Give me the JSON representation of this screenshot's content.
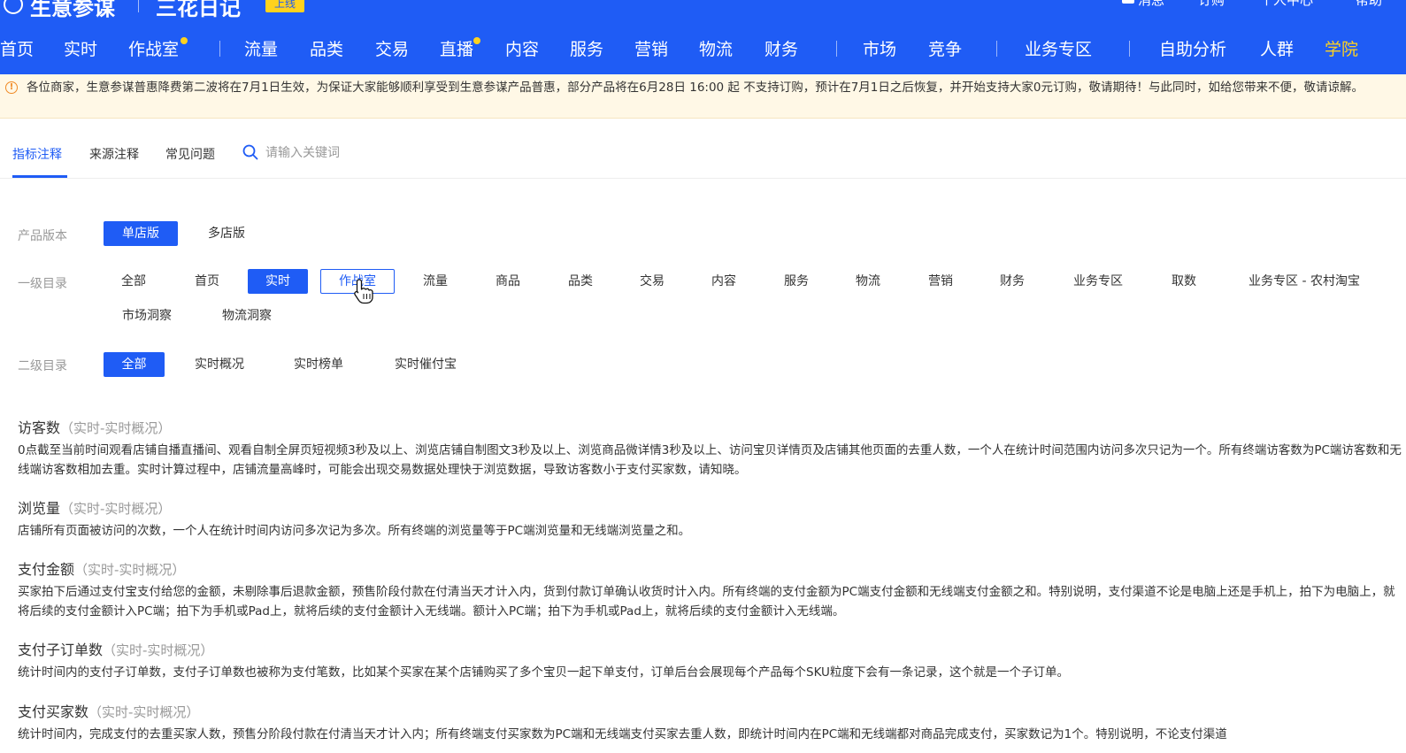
{
  "header": {
    "brand_title": "生意参谋",
    "brand_sub": "三花日记",
    "badge": "上线",
    "links": [
      "消息",
      "订购",
      "个人中心",
      "帮助"
    ]
  },
  "nav": {
    "items": [
      "首页",
      "实时",
      "作战室",
      "流量",
      "品类",
      "交易",
      "直播",
      "内容",
      "服务",
      "营销",
      "物流",
      "财务",
      "市场",
      "竞争",
      "业务专区",
      "自助分析",
      "人群",
      "学院"
    ],
    "active": "学院"
  },
  "notice": {
    "text": "各位商家，生意参谋普惠降费第二波将在7月1日生效，为保证大家能够顺利享受到生意参谋产品普惠，部分产品将在6月28日 16:00 起 不支持订购，预计在7月1日之后恢复，并开始支持大家0元订购，敬请期待！与此同时，如给您带来不便，敬请谅解。"
  },
  "tabs": {
    "items": [
      "指标注释",
      "来源注释",
      "常见问题"
    ],
    "active": "指标注释",
    "search_placeholder": "请输入关键词"
  },
  "filters": {
    "version": {
      "label": "产品版本",
      "options": [
        "单店版",
        "多店版"
      ],
      "active": "单店版"
    },
    "level1": {
      "label": "一级目录",
      "options": [
        "全部",
        "首页",
        "实时",
        "作战室",
        "流量",
        "商品",
        "品类",
        "交易",
        "内容",
        "服务",
        "物流",
        "营销",
        "财务",
        "业务专区",
        "取数",
        "业务专区 - 农村淘宝",
        "市场洞察",
        "物流洞察"
      ],
      "active": "实时",
      "hovered": "作战室"
    },
    "level2": {
      "label": "二级目录",
      "options": [
        "全部",
        "实时概况",
        "实时榜单",
        "实时催付宝"
      ],
      "active": "全部"
    }
  },
  "entries": [
    {
      "title": "访客数",
      "tag": "（实时-实时概况）",
      "desc": "0点截至当前时间观看店铺自播直播间、观看自制全屏页短视频3秒及以上、浏览店铺自制图文3秒及以上、浏览商品微详情3秒及以上、访问宝贝详情页及店铺其他页面的去重人数，一个人在统计时间范围内访问多次只记为一个。所有终端访客数为PC端访客数和无线端访客数相加去重。实时计算过程中，店铺流量高峰时，可能会出现交易数据处理快于浏览数据，导致访客数小于支付买家数，请知晓。"
    },
    {
      "title": "浏览量",
      "tag": "（实时-实时概况）",
      "desc": "店铺所有页面被访问的次数，一个人在统计时间内访问多次记为多次。所有终端的浏览量等于PC端浏览量和无线端浏览量之和。"
    },
    {
      "title": "支付金额",
      "tag": "（实时-实时概况）",
      "desc": "买家拍下后通过支付宝支付给您的金额，未剔除事后退款金额，预售阶段付款在付清当天才计入内，货到付款订单确认收货时计入内。所有终端的支付金额为PC端支付金额和无线端支付金额之和。特别说明，支付渠道不论是电脑上还是手机上，拍下为电脑上，就将后续的支付金额计入PC端；拍下为手机或Pad上，就将后续的支付金额计入无线端。额计入PC端；拍下为手机或Pad上，就将后续的支付金额计入无线端。"
    },
    {
      "title": "支付子订单数",
      "tag": "（实时-实时概况）",
      "desc": "统计时间内的支付子订单数，支付子订单数也被称为支付笔数，比如某个买家在某个店铺购买了多个宝贝一起下单支付，订单后台会展现每个产品每个SKU粒度下会有一条记录，这个就是一个子订单。"
    },
    {
      "title": "支付买家数",
      "tag": "（实时-实时概况）",
      "desc": "统计时间内，完成支付的去重买家人数，预售分阶段付款在付清当天才计入内；所有终端支付买家数为PC端和无线端支付买家去重人数，即统计时间内在PC端和无线端都对商品完成支付，买家数记为1个。特别说明，不论支付渠道"
    }
  ]
}
